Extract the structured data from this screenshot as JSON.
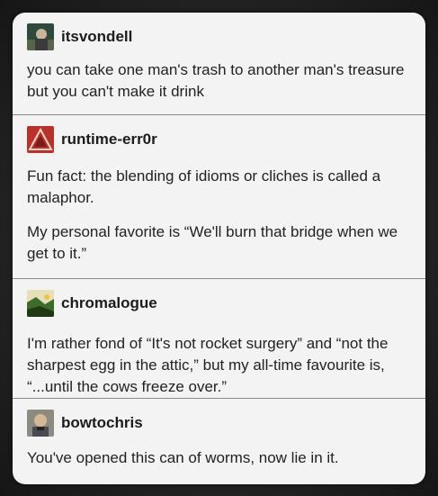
{
  "posts": [
    {
      "username": "itsvondell",
      "avatar_icon": "user-photo-avatar",
      "paragraphs": [
        "you can take one man's trash to another man's treasure but you can't make it drink"
      ]
    },
    {
      "username": "runtime-err0r",
      "avatar_icon": "geometric-triangle-avatar",
      "paragraphs": [
        "Fun fact: the blending of idioms or cliches is called a malaphor.",
        "My personal favorite is “We'll burn that bridge when we get to it.”"
      ]
    },
    {
      "username": "chromalogue",
      "avatar_icon": "landscape-avatar",
      "paragraphs": [
        "I'm rather fond of “It's not rocket surgery” and “not the sharpest egg in the attic,” but my all-time favourite is, “...until the cows freeze over.”"
      ]
    },
    {
      "username": "bowtochris",
      "avatar_icon": "user-photo-avatar",
      "paragraphs": [
        "You've opened this can of worms, now lie in it."
      ]
    }
  ]
}
